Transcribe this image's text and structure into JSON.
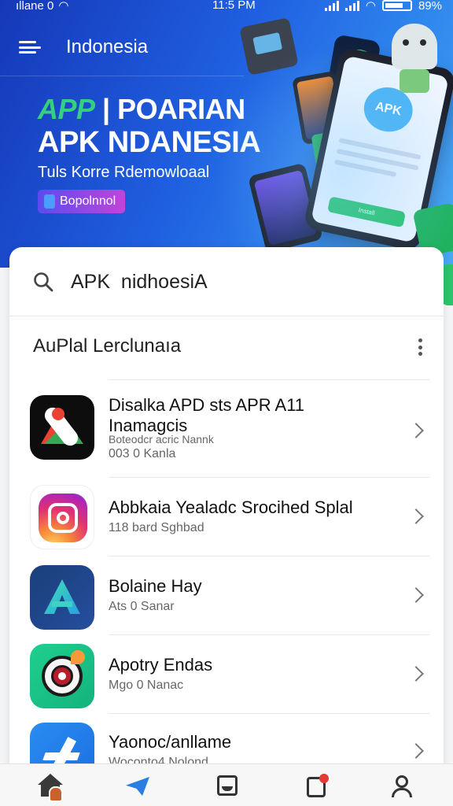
{
  "status_bar": {
    "carrier": "ıllane 0",
    "time": "11:5 PM",
    "battery": "89%"
  },
  "header": {
    "title": "Indonesia"
  },
  "hero": {
    "brand_app": "APP",
    "brand_rest": "POARIAN",
    "headline": "APK NDANESIA",
    "subtitle": "Tuls Korre Rdemowloaal",
    "cta_label": "Bopolnnol",
    "phone_badge": "APK",
    "phone_install": "Install"
  },
  "search": {
    "value": "APK  nidhoesiA",
    "placeholder": ""
  },
  "section": {
    "title": "AuPlal Lerclunaıa"
  },
  "apps": [
    {
      "icon": "maps-icon",
      "title": "Disalka APD sts APR A11",
      "title2": "Inamagcis",
      "sub1": "Boteodcr acric Nannk",
      "sub2": "003 0 Kanla"
    },
    {
      "icon": "instagram-icon",
      "title": "Abbkaia Yealadc Srocihed Splal",
      "title2": "",
      "sub1": "118 bard Sghbad",
      "sub2": ""
    },
    {
      "icon": "a-logo-icon",
      "title": "Bolaine Hay",
      "title2": "",
      "sub1": "Ats 0 Sanar",
      "sub2": ""
    },
    {
      "icon": "target-icon",
      "title": "Apotry Endas",
      "title2": "",
      "sub1": "Mgo 0 Nanac",
      "sub2": ""
    },
    {
      "icon": "blue-arrow-icon",
      "title": "Yaonoc/anllame",
      "title2": "",
      "sub1": "Woconto4 Nolond",
      "sub2": ""
    }
  ],
  "bottom_nav": {
    "items": [
      "home-icon",
      "send-icon",
      "inbox-icon",
      "notification-icon",
      "profile-icon"
    ]
  },
  "colors": {
    "hero_start": "#1538b8",
    "hero_end": "#49a8f3",
    "accent_green": "#2bc46b",
    "cta_start": "#5b4bf0",
    "cta_end": "#c045d8"
  }
}
